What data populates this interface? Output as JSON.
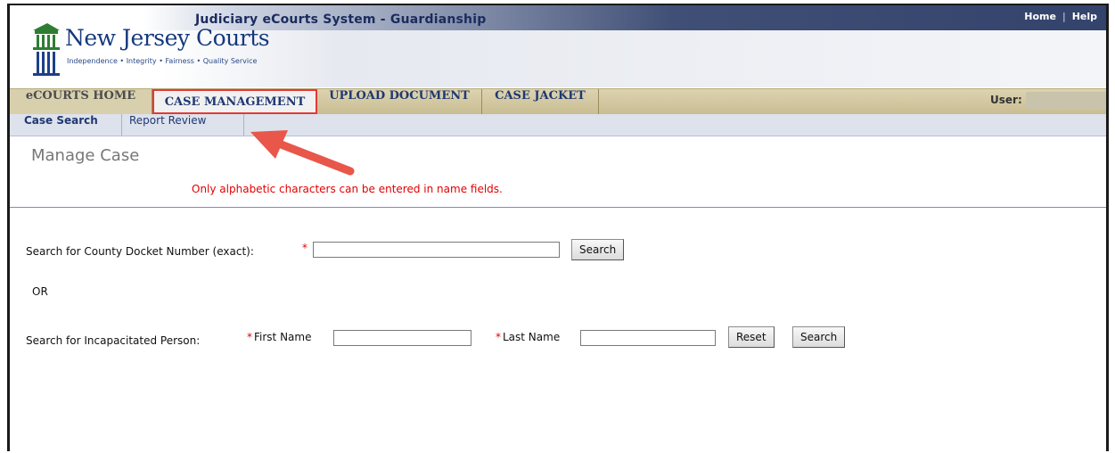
{
  "header": {
    "app_title": "Judiciary eCourts System - Guardianship",
    "links": {
      "home": "Home",
      "separator": "|",
      "help": "Help"
    },
    "logo": {
      "name": "New Jersey Courts",
      "tagline": "Independence • Integrity • Fairness • Quality Service"
    }
  },
  "nav": {
    "tabs": [
      {
        "label": "eCOURTS HOME"
      },
      {
        "label": "CASE MANAGEMENT"
      },
      {
        "label": "UPLOAD DOCUMENT"
      },
      {
        "label": "CASE JACKET"
      }
    ],
    "active_tab": "CASE MANAGEMENT",
    "user_label": "User:"
  },
  "subnav": {
    "items": [
      {
        "label": "Case Search"
      },
      {
        "label": "Report Review"
      }
    ],
    "active_item": "Case Search"
  },
  "main": {
    "title": "Manage Case",
    "validation_message": "Only alphabetic characters can be entered in name fields.",
    "docket_search": {
      "label": "Search for County Docket Number (exact):",
      "required_mark": "*",
      "value": "",
      "search_button": "Search"
    },
    "or_label": "OR",
    "person_search": {
      "label": "Search for Incapacitated Person:",
      "required_mark": "*",
      "first_name_label": "First Name",
      "first_name_value": "",
      "last_name_label": "Last Name",
      "last_name_value": "",
      "reset_button": "Reset",
      "search_button": "Search"
    }
  },
  "colors": {
    "title_bar_dark": "#33436b",
    "nav_bar": "#d2c8a2",
    "subnav_bar": "#dde2ec",
    "error_red": "#e20000",
    "highlight_border": "#e53935",
    "annotation_arrow": "#e8574a"
  }
}
